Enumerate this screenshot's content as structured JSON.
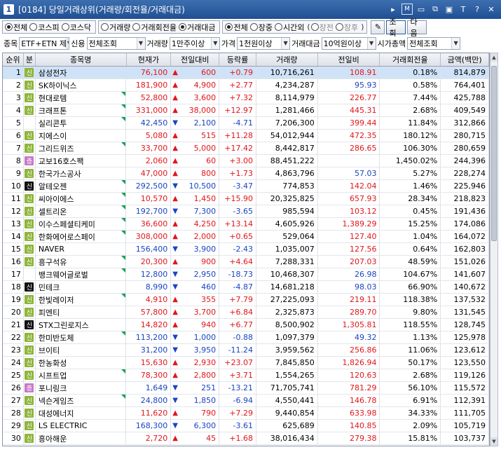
{
  "window": {
    "screen_no": "1",
    "title": "[0184] 당일거래상위(거래량/회전율/거래대금)",
    "icons": [
      "dropdown-arrow-icon",
      "m-icon",
      "layout-icon",
      "link-icon",
      "window-icon",
      "font-icon",
      "help-icon",
      "close-icon"
    ]
  },
  "toolbar1": {
    "market_options": [
      {
        "label": "전체",
        "selected": true
      },
      {
        "label": "코스피",
        "selected": false
      },
      {
        "label": "코스닥",
        "selected": false
      }
    ],
    "sort_options": [
      {
        "label": "거래량",
        "selected": false
      },
      {
        "label": "거래회전율",
        "selected": false
      },
      {
        "label": "거래대금",
        "selected": true
      }
    ],
    "session_options": [
      {
        "label": "전체",
        "selected": true
      },
      {
        "label": "장중",
        "selected": false
      },
      {
        "label": "시간외",
        "selected": false
      }
    ],
    "after_hours_options": [
      {
        "label": "장전",
        "selected": false
      },
      {
        "label": "장후",
        "selected": false
      }
    ],
    "tool_button_label": "",
    "query_button": "조회",
    "next_button": "다음"
  },
  "toolbar2": {
    "stock_label": "종목",
    "stock_value": "ETF+ETN 제",
    "credit_label": "신용",
    "credit_value": "전체조회",
    "volume_label": "거래량",
    "volume_value": "1만주이상",
    "price_label": "가격",
    "price_value": "1천원이상",
    "amount_label": "거래대금",
    "amount_value": "10억원이상",
    "cap_label": "시가총액",
    "cap_value": "전체조회"
  },
  "columns": [
    "순위",
    "분",
    "종목명",
    "현재가",
    "전일대비",
    "등락률",
    "거래량",
    "전일비",
    "거래회전율",
    "금액(백만)"
  ],
  "colors": {
    "up": "#e0161b",
    "down": "#1a44c4",
    "selected_row": "#cfe2f7",
    "badge_new": "#8fb63a",
    "badge_margin": "#c879c8"
  },
  "rows": [
    {
      "rank": "1",
      "cls": "신",
      "clsType": "shin",
      "flag": false,
      "name": "삼성전자",
      "price": "76,100",
      "dir": "up",
      "change": "600",
      "pct": "+0.79",
      "volume": "10,716,261",
      "prev": "108.91",
      "prevDir": "up",
      "turnover": "0.18%",
      "amount": "814,879",
      "selected": true
    },
    {
      "rank": "2",
      "cls": "신",
      "clsType": "shin",
      "flag": false,
      "name": "SK하이닉스",
      "price": "181,900",
      "dir": "up",
      "change": "4,900",
      "pct": "+2.77",
      "volume": "4,234,287",
      "prev": "95.93",
      "prevDir": "down",
      "turnover": "0.58%",
      "amount": "764,401"
    },
    {
      "rank": "3",
      "cls": "신",
      "clsType": "shin",
      "flag": true,
      "name": "현대로템",
      "price": "52,800",
      "dir": "up",
      "change": "3,600",
      "pct": "+7.32",
      "volume": "8,114,979",
      "prev": "226.77",
      "prevDir": "up",
      "turnover": "7.44%",
      "amount": "425,788"
    },
    {
      "rank": "4",
      "cls": "신",
      "clsType": "shin",
      "flag": true,
      "name": "크래프톤",
      "price": "331,000",
      "dir": "up",
      "change": "38,000",
      "pct": "+12.97",
      "volume": "1,281,466",
      "prev": "445.31",
      "prevDir": "up",
      "turnover": "2.68%",
      "amount": "409,549"
    },
    {
      "rank": "5",
      "cls": "",
      "clsType": "",
      "flag": true,
      "name": "실리콘투",
      "price": "42,450",
      "dir": "down",
      "change": "2,100",
      "pct": "-4.71",
      "volume": "7,206,300",
      "prev": "399.44",
      "prevDir": "up",
      "turnover": "11.84%",
      "amount": "312,866"
    },
    {
      "rank": "6",
      "cls": "신",
      "clsType": "shin",
      "flag": false,
      "name": "지에스이",
      "price": "5,080",
      "dir": "up",
      "change": "515",
      "pct": "+11.28",
      "volume": "54,012,944",
      "prev": "472.35",
      "prevDir": "up",
      "turnover": "180.12%",
      "amount": "280,715"
    },
    {
      "rank": "7",
      "cls": "신",
      "clsType": "shin",
      "flag": true,
      "name": "그리드위즈",
      "price": "33,700",
      "dir": "up",
      "change": "5,000",
      "pct": "+17.42",
      "volume": "8,442,817",
      "prev": "286.65",
      "prevDir": "up",
      "turnover": "106.30%",
      "amount": "280,659"
    },
    {
      "rank": "8",
      "cls": "증",
      "clsType": "jeung",
      "flag": false,
      "name": "교보16호스팩",
      "price": "2,060",
      "dir": "up",
      "change": "60",
      "pct": "+3.00",
      "volume": "88,451,222",
      "prev": "",
      "prevDir": "",
      "turnover": "1,450.02%",
      "amount": "244,396"
    },
    {
      "rank": "9",
      "cls": "신",
      "clsType": "shin",
      "flag": false,
      "name": "한국가스공사",
      "price": "47,000",
      "dir": "up",
      "change": "800",
      "pct": "+1.73",
      "volume": "4,863,796",
      "prev": "57.03",
      "prevDir": "down",
      "turnover": "5.27%",
      "amount": "228,274"
    },
    {
      "rank": "10",
      "cls": "신",
      "clsType": "black",
      "flag": true,
      "name": "알테오젠",
      "price": "292,500",
      "dir": "down",
      "change": "10,500",
      "pct": "-3.47",
      "volume": "774,853",
      "prev": "142.04",
      "prevDir": "up",
      "turnover": "1.46%",
      "amount": "225,946"
    },
    {
      "rank": "11",
      "cls": "신",
      "clsType": "shin",
      "flag": true,
      "name": "씨아이에스",
      "price": "10,570",
      "dir": "up",
      "change": "1,450",
      "pct": "+15.90",
      "volume": "20,325,825",
      "prev": "657.93",
      "prevDir": "up",
      "turnover": "28.34%",
      "amount": "218,823"
    },
    {
      "rank": "12",
      "cls": "신",
      "clsType": "shin",
      "flag": true,
      "name": "셀트리온",
      "price": "192,700",
      "dir": "down",
      "change": "7,300",
      "pct": "-3.65",
      "volume": "985,594",
      "prev": "103.12",
      "prevDir": "up",
      "turnover": "0.45%",
      "amount": "191,436"
    },
    {
      "rank": "13",
      "cls": "신",
      "clsType": "shin",
      "flag": true,
      "name": "이수스페셜티케미",
      "price": "36,600",
      "dir": "up",
      "change": "4,250",
      "pct": "+13.14",
      "volume": "4,605,926",
      "prev": "1,389.29",
      "prevDir": "up",
      "turnover": "15.25%",
      "amount": "174,086"
    },
    {
      "rank": "14",
      "cls": "신",
      "clsType": "shin",
      "flag": true,
      "name": "한화에어로스페이",
      "price": "308,000",
      "dir": "up",
      "change": "2,000",
      "pct": "+0.65",
      "volume": "529,064",
      "prev": "127.40",
      "prevDir": "up",
      "turnover": "1.04%",
      "amount": "164,072"
    },
    {
      "rank": "15",
      "cls": "신",
      "clsType": "shin",
      "flag": false,
      "name": "NAVER",
      "price": "156,400",
      "dir": "down",
      "change": "3,900",
      "pct": "-2.43",
      "volume": "1,035,007",
      "prev": "127.56",
      "prevDir": "up",
      "turnover": "0.64%",
      "amount": "162,803"
    },
    {
      "rank": "16",
      "cls": "신",
      "clsType": "shin",
      "flag": true,
      "name": "흥구석유",
      "price": "20,300",
      "dir": "up",
      "change": "900",
      "pct": "+4.64",
      "volume": "7,288,331",
      "prev": "207.03",
      "prevDir": "up",
      "turnover": "48.59%",
      "amount": "151,026"
    },
    {
      "rank": "17",
      "cls": "",
      "clsType": "",
      "flag": true,
      "name": "뱅크웨어글로벌",
      "price": "12,800",
      "dir": "down",
      "change": "2,950",
      "pct": "-18.73",
      "volume": "10,468,307",
      "prev": "26.98",
      "prevDir": "down",
      "turnover": "104.67%",
      "amount": "141,607"
    },
    {
      "rank": "18",
      "cls": "신",
      "clsType": "black",
      "flag": false,
      "name": "민테크",
      "price": "8,990",
      "dir": "down",
      "change": "460",
      "pct": "-4.87",
      "volume": "14,681,218",
      "prev": "98.03",
      "prevDir": "down",
      "turnover": "66.90%",
      "amount": "140,672"
    },
    {
      "rank": "19",
      "cls": "신",
      "clsType": "shin",
      "flag": true,
      "name": "한빛레이저",
      "price": "4,910",
      "dir": "up",
      "change": "355",
      "pct": "+7.79",
      "volume": "27,225,093",
      "prev": "219.11",
      "prevDir": "up",
      "turnover": "118.38%",
      "amount": "137,532"
    },
    {
      "rank": "20",
      "cls": "신",
      "clsType": "shin",
      "flag": false,
      "name": "피엔티",
      "price": "57,800",
      "dir": "up",
      "change": "3,700",
      "pct": "+6.84",
      "volume": "2,325,873",
      "prev": "289.70",
      "prevDir": "up",
      "turnover": "9.80%",
      "amount": "131,545"
    },
    {
      "rank": "21",
      "cls": "신",
      "clsType": "black",
      "flag": false,
      "name": "STX그린로지스",
      "price": "14,820",
      "dir": "up",
      "change": "940",
      "pct": "+6.77",
      "volume": "8,500,902",
      "prev": "1,305.81",
      "prevDir": "up",
      "turnover": "118.55%",
      "amount": "128,745"
    },
    {
      "rank": "22",
      "cls": "신",
      "clsType": "shin",
      "flag": true,
      "name": "한미반도체",
      "price": "113,200",
      "dir": "down",
      "change": "1,000",
      "pct": "-0.88",
      "volume": "1,097,379",
      "prev": "49.32",
      "prevDir": "down",
      "turnover": "1.13%",
      "amount": "125,978"
    },
    {
      "rank": "23",
      "cls": "신",
      "clsType": "shin",
      "flag": false,
      "name": "브이티",
      "price": "31,200",
      "dir": "down",
      "change": "3,950",
      "pct": "-11.24",
      "volume": "3,959,562",
      "prev": "256.86",
      "prevDir": "up",
      "turnover": "11.06%",
      "amount": "123,612"
    },
    {
      "rank": "24",
      "cls": "신",
      "clsType": "shin",
      "flag": false,
      "name": "한농화성",
      "price": "15,630",
      "dir": "up",
      "change": "2,930",
      "pct": "+23.07",
      "volume": "7,845,850",
      "prev": "1,826.94",
      "prevDir": "up",
      "turnover": "50.17%",
      "amount": "123,550"
    },
    {
      "rank": "25",
      "cls": "신",
      "clsType": "shin",
      "flag": true,
      "name": "시프트업",
      "price": "78,300",
      "dir": "up",
      "change": "2,800",
      "pct": "+3.71",
      "volume": "1,554,265",
      "prev": "120.63",
      "prevDir": "up",
      "turnover": "2.68%",
      "amount": "119,126"
    },
    {
      "rank": "26",
      "cls": "증",
      "clsType": "jeung",
      "flag": false,
      "name": "포니링크",
      "price": "1,649",
      "dir": "down",
      "change": "251",
      "pct": "-13.21",
      "volume": "71,705,741",
      "prev": "781.29",
      "prevDir": "up",
      "turnover": "56.10%",
      "amount": "115,572"
    },
    {
      "rank": "27",
      "cls": "신",
      "clsType": "shin",
      "flag": true,
      "name": "넥슨게임즈",
      "price": "24,800",
      "dir": "down",
      "change": "1,850",
      "pct": "-6.94",
      "volume": "4,550,441",
      "prev": "146.78",
      "prevDir": "up",
      "turnover": "6.91%",
      "amount": "112,391"
    },
    {
      "rank": "28",
      "cls": "신",
      "clsType": "shin",
      "flag": false,
      "name": "대성에너지",
      "price": "11,620",
      "dir": "up",
      "change": "790",
      "pct": "+7.29",
      "volume": "9,440,854",
      "prev": "633.98",
      "prevDir": "up",
      "turnover": "34.33%",
      "amount": "111,705"
    },
    {
      "rank": "29",
      "cls": "신",
      "clsType": "shin",
      "flag": false,
      "name": "LS ELECTRIC",
      "price": "168,300",
      "dir": "down",
      "change": "6,300",
      "pct": "-3.61",
      "volume": "625,689",
      "prev": "140.85",
      "prevDir": "up",
      "turnover": "2.09%",
      "amount": "105,719"
    },
    {
      "rank": "30",
      "cls": "신",
      "clsType": "shin",
      "flag": false,
      "name": "흥아해운",
      "price": "2,720",
      "dir": "up",
      "change": "45",
      "pct": "+1.68",
      "volume": "38,016,434",
      "prev": "279.38",
      "prevDir": "up",
      "turnover": "15.81%",
      "amount": "103,737"
    }
  ]
}
